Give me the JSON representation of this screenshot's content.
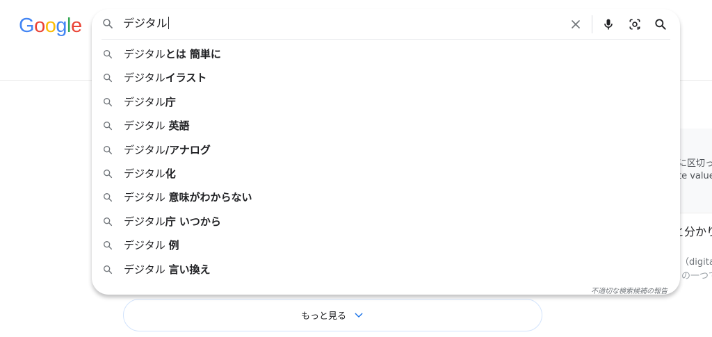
{
  "logo": {
    "letters": [
      "G",
      "o",
      "o",
      "g",
      "l",
      "e"
    ],
    "colors": [
      "#4285F4",
      "#EA4335",
      "#FBBC05",
      "#4285F4",
      "#34A853",
      "#EA4335"
    ]
  },
  "search": {
    "query": "デジタル"
  },
  "suggestions": [
    {
      "prefix": "デジタル",
      "bold": "とは 簡単に"
    },
    {
      "prefix": "デジタル",
      "bold": "イラスト"
    },
    {
      "prefix": "デジタル",
      "bold": "庁"
    },
    {
      "prefix": "デジタル ",
      "bold": "英語"
    },
    {
      "prefix": "デジタル",
      "bold": "/アナログ"
    },
    {
      "prefix": "デジタル",
      "bold": "化"
    },
    {
      "prefix": "デジタル ",
      "bold": "意味がわからない"
    },
    {
      "prefix": "デジタル",
      "bold": "庁 いつから"
    },
    {
      "prefix": "デジタル ",
      "bold": "例"
    },
    {
      "prefix": "デジタル ",
      "bold": "言い換え"
    }
  ],
  "report_link": "不適切な検索候補の報告",
  "more_button": {
    "label": "もっと見る"
  },
  "background": {
    "snippet1": "に区切っ",
    "snippet2": "te value",
    "heading": "と分かり",
    "snippet3": "（digital）",
    "snippet4": "の一つで"
  },
  "colors": {
    "accent": "#1a73e8",
    "icon_gray": "#70757a"
  }
}
